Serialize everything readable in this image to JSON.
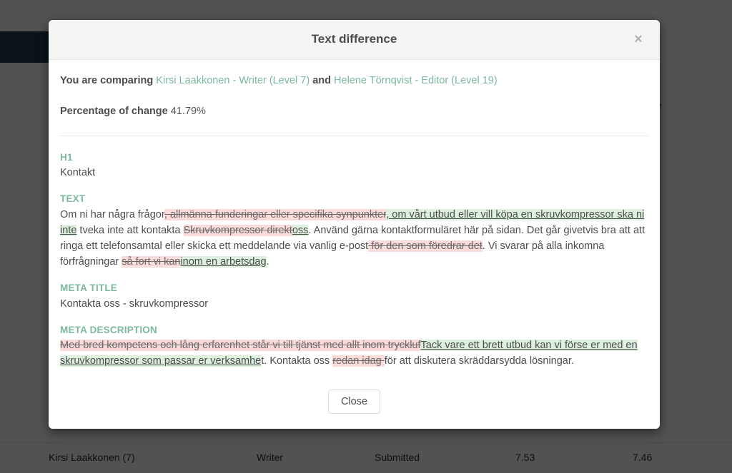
{
  "background_page": {
    "nav_block_color": "#1d3c4e",
    "partial_text_fragment": "e",
    "table_row": {
      "author": "Kirsi Laakkonen (7)",
      "role": "Writer",
      "status": "Submitted",
      "score_a": "7.53",
      "score_b": "7.46"
    }
  },
  "modal": {
    "title": "Text difference",
    "close_icon": "×",
    "compare": {
      "prefix": "You are comparing ",
      "left": "Kirsi Laakkonen - Writer (Level 7)",
      "middle": " and ",
      "right": "Helene Törnqvist - Editor (Level 19)"
    },
    "percentage": {
      "label": "Percentage of change ",
      "value": "41.79%"
    },
    "accent_color": "#7cba9b",
    "delete_color": "#fbdada",
    "insert_color": "#ddf0dd",
    "fields": [
      {
        "label": "H1",
        "segments": [
          {
            "type": "equal",
            "text": "Kontakt"
          }
        ]
      },
      {
        "label": "TEXT",
        "segments": [
          {
            "type": "equal",
            "text": "Om ni har några frågor"
          },
          {
            "type": "delete",
            "text": ", allmänna funderingar eller specifika synpunkter"
          },
          {
            "type": "insert",
            "text": ", om vårt utbud eller vill köpa en skruvkompressor ska ni inte"
          },
          {
            "type": "equal",
            "text": " tveka inte att kontakta "
          },
          {
            "type": "delete",
            "text": "Skruvkompressor direkt"
          },
          {
            "type": "insert",
            "text": "oss"
          },
          {
            "type": "equal",
            "text": ". Använd gärna kontaktformuläret här på sidan. Det går givetvis bra att att ringa ett telefonsamtal eller skicka ett meddelande via vanlig e-post"
          },
          {
            "type": "delete",
            "text": " för den som föredrar det"
          },
          {
            "type": "equal",
            "text": ". Vi svarar på alla inkomna förfrågningar "
          },
          {
            "type": "delete",
            "text": "så fort vi kan"
          },
          {
            "type": "insert",
            "text": "inom en arbetsdag"
          },
          {
            "type": "equal",
            "text": "."
          }
        ]
      },
      {
        "label": "META TITLE",
        "segments": [
          {
            "type": "equal",
            "text": "Kontakta oss - skruvkompressor"
          }
        ]
      },
      {
        "label": "META DESCRIPTION",
        "segments": [
          {
            "type": "delete",
            "text": "Med bred kompetens och lång erfarenhet står vi till tjänst med allt inom tryckluf"
          },
          {
            "type": "insert",
            "text": "Tack vare ett brett utbud kan vi förse er med en skruvkompressor som passar er verksamhe"
          },
          {
            "type": "equal",
            "text": "t. Kontakta oss "
          },
          {
            "type": "delete",
            "text": "redan idag "
          },
          {
            "type": "equal",
            "text": "för att diskutera skräddarsydda lösningar."
          }
        ]
      }
    ],
    "footer": {
      "close_label": "Close"
    }
  }
}
